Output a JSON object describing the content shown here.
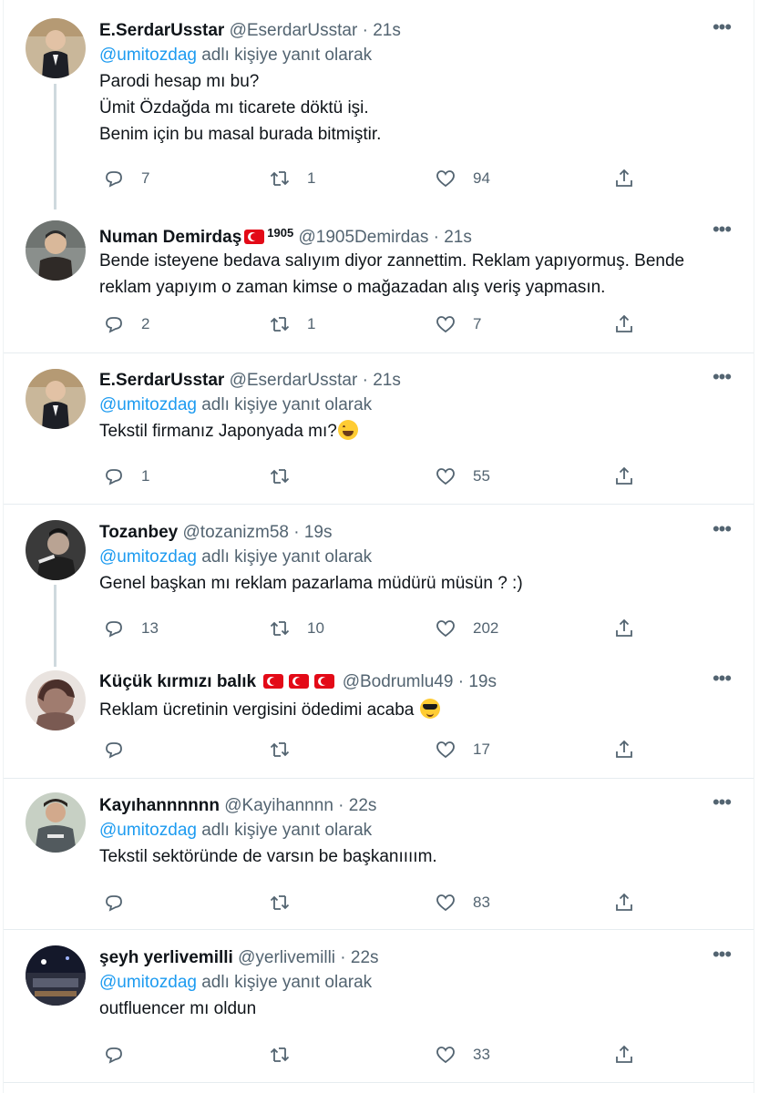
{
  "reply_prefix": "adlı kişiye yanıt olarak",
  "tweets": [
    {
      "name": "E.SerdarUsstar",
      "handle": "@EserdarUsstar",
      "dot": "·",
      "time": "21s",
      "reply_to": "@umitozdag",
      "lines": [
        "Parodi hesap mı bu?",
        "Ümit Özdağda mı ticarete döktü işi.",
        "Benim için bu masal burada bitmiştir."
      ],
      "replies": "7",
      "retweets": "1",
      "likes": "94"
    },
    {
      "name": "Numan Demirdaş",
      "name_suffix": "1905",
      "handle": "@1905Demirdas",
      "dot": "·",
      "time": "21s",
      "lines": [
        "Bende isteyene bedava salıyım diyor zannettim. Reklam yapıyormuş. Bende",
        "reklam yapıyım o zaman kimse o mağazadan alış veriş yapmasın."
      ],
      "replies": "2",
      "retweets": "1",
      "likes": "7"
    },
    {
      "name": "E.SerdarUsstar",
      "handle": "@EserdarUsstar",
      "dot": "·",
      "time": "21s",
      "reply_to": "@umitozdag",
      "lines": [
        "Tekstil firmanız Japonyada mı?"
      ],
      "replies": "1",
      "retweets": "",
      "likes": "55"
    },
    {
      "name": "Tozanbey",
      "handle": "@tozanizm58",
      "dot": "·",
      "time": "19s",
      "reply_to": "@umitozdag",
      "lines": [
        "Genel başkan mı reklam pazarlama müdürü müsün ? :)"
      ],
      "replies": "13",
      "retweets": "10",
      "likes": "202"
    },
    {
      "name": "Küçük kırmızı balık",
      "handle": "@Bodrumlu49",
      "dot": "·",
      "time": "19s",
      "lines": [
        "Reklam ücretinin vergisini ödedimi acaba"
      ],
      "replies": "",
      "retweets": "",
      "likes": "17"
    },
    {
      "name": "Kayıhannnnnn",
      "handle": "@Kayihannnn",
      "dot": "·",
      "time": "22s",
      "reply_to": "@umitozdag",
      "lines": [
        "Tekstil sektöründe de varsın be başkanıııım."
      ],
      "replies": "",
      "retweets": "",
      "likes": "83"
    },
    {
      "name": "şeyh yerlivemilli",
      "handle": "@yerlivemilli",
      "dot": "·",
      "time": "22s",
      "reply_to": "@umitozdag",
      "lines": [
        "outfluencer mı oldun"
      ],
      "replies": "",
      "retweets": "",
      "likes": "33"
    }
  ],
  "icons": {
    "more": "more-icon",
    "reply": "reply-icon",
    "retweet": "retweet-icon",
    "like": "like-icon",
    "share": "share-icon",
    "flag": "turkish-flag-icon"
  },
  "colors": {
    "link": "#1d9bf0",
    "muted": "#536471",
    "text": "#0f1419",
    "thread_line": "#cfd9de"
  }
}
